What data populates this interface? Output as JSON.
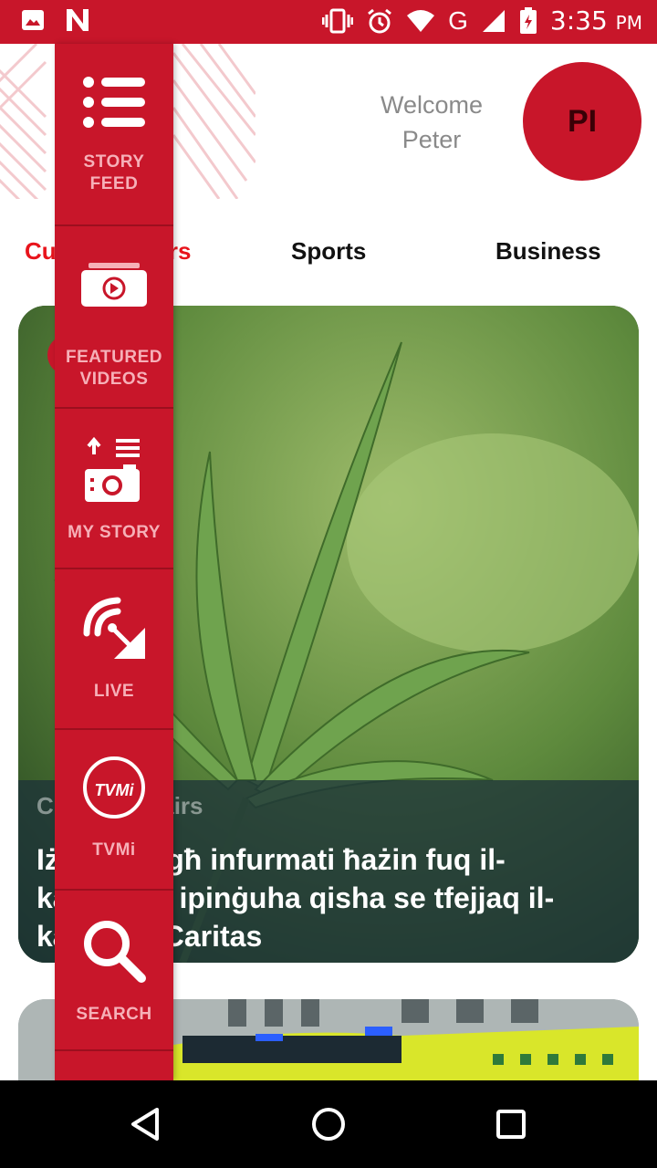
{
  "status_bar": {
    "time": "3:35",
    "ampm": "PM",
    "network": "G"
  },
  "header": {
    "welcome_line1": "Welcome",
    "welcome_line2": "Peter",
    "avatar_initials": "PI"
  },
  "tabs": [
    {
      "label": "Current Affairs",
      "active": true
    },
    {
      "label": "Sports",
      "active": false
    },
    {
      "label": "Business",
      "active": false
    }
  ],
  "side_menu": {
    "items": [
      {
        "label_line1": "STORY",
        "label_line2": "FEED",
        "icon": "list-icon"
      },
      {
        "label_line1": "FEATURED",
        "label_line2": "VIDEOS",
        "icon": "video-icon"
      },
      {
        "label_line1": "MY STORY",
        "label_line2": "",
        "icon": "upload-camera-icon"
      },
      {
        "label_line1": "LIVE",
        "label_line2": "",
        "icon": "live-broadcast-icon"
      },
      {
        "label_line1": "TVMi",
        "label_line2": "",
        "icon": "tvmi-logo-icon"
      },
      {
        "label_line1": "SEARCH",
        "label_line2": "",
        "icon": "search-icon"
      }
    ]
  },
  "cards": [
    {
      "category": "Current Affairs",
      "headline": "Iż-żagħżagħ infurmati ħażin fuq il-kannabis, ipinġuha qisha se tfejjaq il-kanċer – Caritas"
    }
  ],
  "tvmi_logo_text": "TVMi",
  "colors": {
    "brand_red": "#c8162a",
    "active_tab": "#e8141c",
    "menu_label": "#f6b0b8"
  }
}
